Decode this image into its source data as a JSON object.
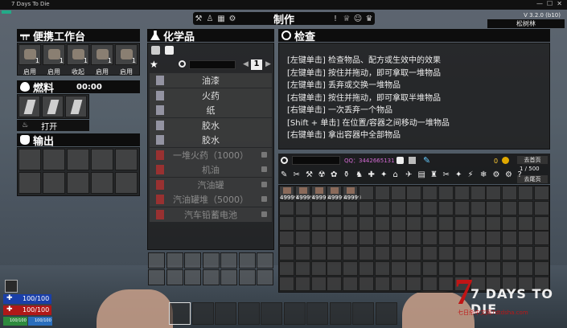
{
  "window": {
    "title": "7 Days To Die"
  },
  "topbar": {
    "center_title": "制作",
    "version": "V 3.2.0 (b10)",
    "player_name": "松树林"
  },
  "portable_workbench": {
    "title": "便携工作台",
    "slots": [
      {
        "count": "1",
        "label": "启用"
      },
      {
        "count": "1",
        "label": "启用"
      },
      {
        "count": "1",
        "label": "收起"
      },
      {
        "count": "1",
        "label": "启用"
      },
      {
        "count": "1",
        "label": "启用"
      }
    ]
  },
  "fuel": {
    "title": "燃料",
    "timer": "00:00",
    "button": "打开"
  },
  "output": {
    "title": "输出"
  },
  "chemistry": {
    "title": "化学品",
    "page": "1",
    "items": [
      {
        "name": "油漆",
        "locked": false
      },
      {
        "name": "火药",
        "locked": false
      },
      {
        "name": "纸",
        "locked": false
      },
      {
        "name": "胶水",
        "locked": false
      },
      {
        "name": "胶水",
        "locked": false
      },
      {
        "name": "一堆火药（1000）",
        "locked": true
      },
      {
        "name": "机油",
        "locked": true
      },
      {
        "name": "汽油罐",
        "locked": true
      },
      {
        "name": "汽油罐堆（5000）",
        "locked": true
      },
      {
        "name": "汽车铅蓄电池",
        "locked": true
      }
    ]
  },
  "inspect": {
    "title": "检查",
    "lines": [
      "[左键单击] 检查物品、配方或生效中的效果",
      "[左键单击] 按住并拖动，即可拿取一堆物品",
      "[左键单击] 丢弃或交换一堆物品",
      "[右键单击] 按住并拖动，即可拿取半堆物品",
      "[右键单击] 一次丢弃一个物品",
      "[Shift + 单击] 在位置/容器之间移动一堆物品",
      "[右键单击] 拿出容器中全部物品"
    ]
  },
  "storage": {
    "qq": "QQ：3442665131",
    "coins": "0",
    "first_page": "去首页",
    "page": "1 / 500",
    "last_page": "去尾页",
    "item_qty": [
      "49999",
      "49999",
      "49999",
      "49999",
      "49999"
    ]
  },
  "stats": {
    "health": "100/100",
    "stamina": "100/100",
    "food": "100/100",
    "water": "100/100"
  },
  "logo": {
    "text": "7 DAYS TO DIE",
    "sub": "七日杀中文网7dtdsha.com"
  }
}
